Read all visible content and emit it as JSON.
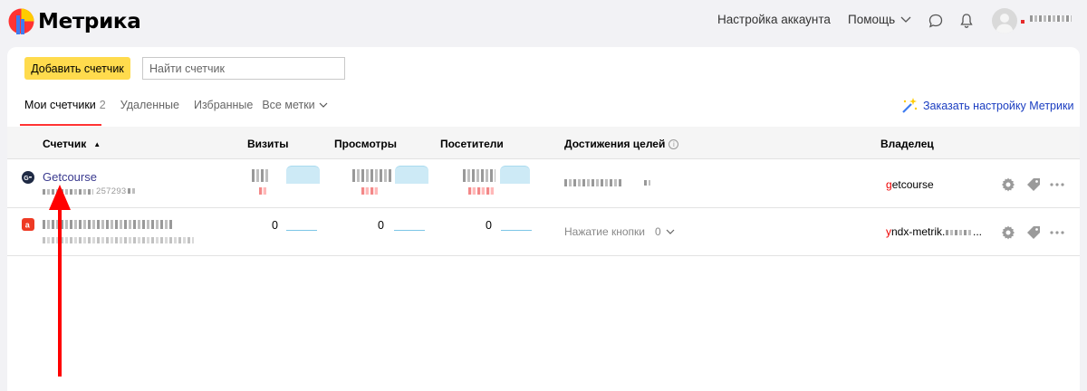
{
  "header": {
    "logo_text": "Метрика",
    "account_settings": "Настройка аккаунта",
    "help": "Помощь"
  },
  "toolbar": {
    "add_counter": "Добавить счетчик",
    "search_placeholder": "Найти счетчик"
  },
  "tabs": {
    "my_counters": "Мои счетчики",
    "my_counters_count": "2",
    "deleted": "Удаленные",
    "favorites": "Избранные",
    "all_tags": "Все метки"
  },
  "order_setup": "Заказать настройку Метрики",
  "columns": {
    "counter": "Счетчик",
    "visits": "Визиты",
    "views": "Просмотры",
    "visitors": "Посетители",
    "goals": "Достижения целей",
    "owner": "Владелец"
  },
  "rows": [
    {
      "name": "Getcourse",
      "id_suffix": "257293",
      "owner_first": "g",
      "owner_rest": "etcourse"
    },
    {
      "visits": "0",
      "views": "0",
      "visitors": "0",
      "goal_name": "Нажатие кнопки",
      "goal_value": "0",
      "owner_first": "y",
      "owner_rest": "ndx-metrik.",
      "owner_ellipsis": "..."
    }
  ],
  "colors": {
    "accent_yellow": "#ffdb4d",
    "link_blue": "#1a3dc1",
    "active_tab_red": "#ff3333",
    "annotation_arrow": "#ff0000"
  }
}
